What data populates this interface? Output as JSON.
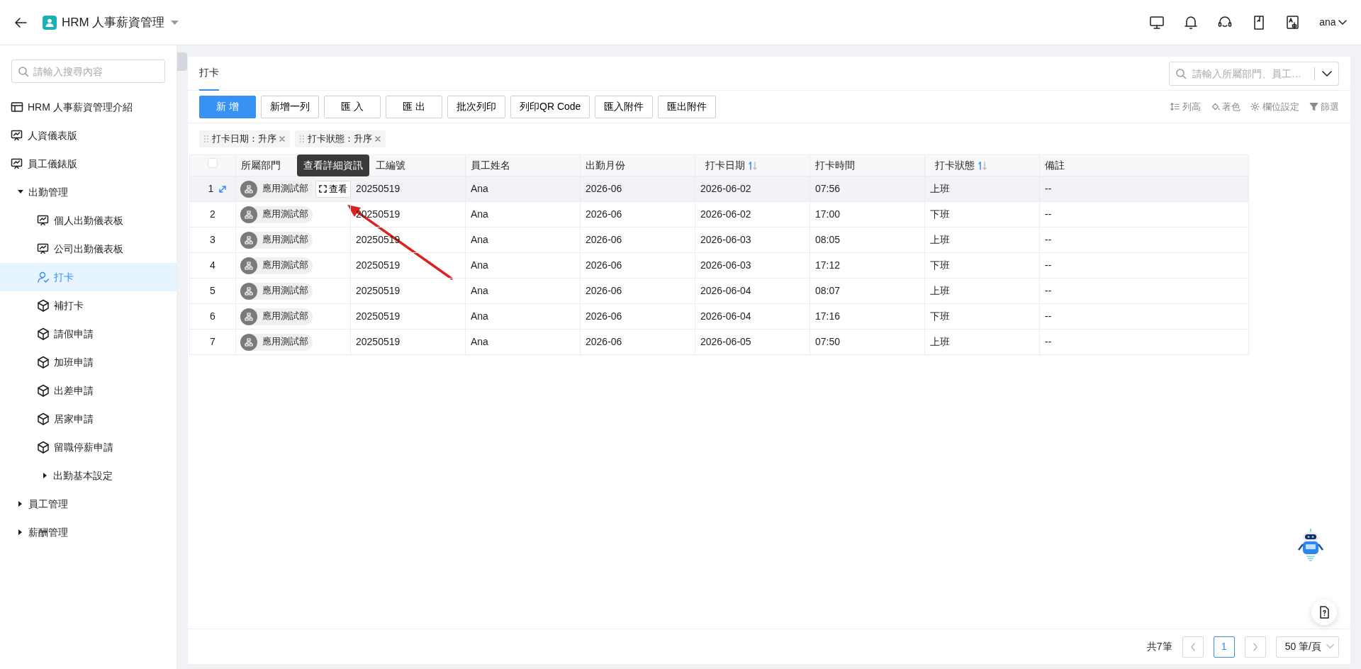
{
  "app": {
    "title": "HRM 人事薪資管理"
  },
  "user": {
    "name": "ana"
  },
  "sidebar": {
    "search": {
      "placeholder": "請輸入搜尋內容"
    },
    "items": [
      {
        "label": "HRM 人事薪資管理介紹",
        "kind": "table",
        "selected": false
      },
      {
        "label": "人資儀表版",
        "kind": "dashboard",
        "selected": false
      },
      {
        "label": "員工儀錶版",
        "kind": "dashboard",
        "selected": false
      },
      {
        "label": "出勤管理",
        "kind": "folder",
        "selected": false,
        "expanded": true,
        "children": [
          {
            "label": "個人出勤儀表板",
            "kind": "dashboard",
            "selected": false
          },
          {
            "label": "公司出勤儀表板",
            "kind": "dashboard",
            "selected": false
          },
          {
            "label": "打卡",
            "kind": "user",
            "selected": true
          },
          {
            "label": "補打卡",
            "kind": "cube",
            "selected": false
          },
          {
            "label": "請假申請",
            "kind": "cube",
            "selected": false
          },
          {
            "label": "加班申請",
            "kind": "cube",
            "selected": false
          },
          {
            "label": "出差申請",
            "kind": "cube",
            "selected": false
          },
          {
            "label": "居家申請",
            "kind": "cube",
            "selected": false
          },
          {
            "label": "留職停薪申請",
            "kind": "cube",
            "selected": false
          },
          {
            "label": "出勤基本設定",
            "kind": "folder",
            "selected": false,
            "expanded": false
          }
        ]
      },
      {
        "label": "員工管理",
        "kind": "folder",
        "selected": false,
        "expanded": false
      },
      {
        "label": "薪酬管理",
        "kind": "folder",
        "selected": false,
        "expanded": false
      }
    ]
  },
  "page": {
    "tabs": [
      {
        "label": "打卡",
        "selected": true
      }
    ],
    "search": {
      "placeholder": "請輸入所屬部門、員工…"
    },
    "buttons": [
      {
        "label": "新 增",
        "kind": "primary"
      },
      {
        "label": "新增一列",
        "kind": "default"
      },
      {
        "label": "匯 入",
        "kind": "default"
      },
      {
        "label": "匯 出",
        "kind": "default"
      },
      {
        "label": "批次列印",
        "kind": "default"
      },
      {
        "label": "列印QR Code",
        "kind": "default"
      },
      {
        "label": "匯入附件",
        "kind": "default"
      },
      {
        "label": "匯出附件",
        "kind": "default"
      }
    ],
    "tools": [
      {
        "label": "列高",
        "kind": "row-height"
      },
      {
        "label": "著色",
        "kind": "color"
      },
      {
        "label": "欄位設定",
        "kind": "settings"
      },
      {
        "label": "篩選",
        "kind": "filter"
      }
    ],
    "sort_chips": [
      {
        "label": "打卡日期：升序"
      },
      {
        "label": "打卡狀態：升序"
      }
    ]
  },
  "table": {
    "select_all_checked": false,
    "columns": [
      {
        "label": "所屬部門"
      },
      {
        "label": "工編號"
      },
      {
        "label": "員工姓名"
      },
      {
        "label": "出勤月份"
      },
      {
        "label": "打卡日期",
        "sorted_ascending": true
      },
      {
        "label": "打卡時間"
      },
      {
        "label": "打卡狀態",
        "sorted_ascending": true
      },
      {
        "label": "備註"
      }
    ],
    "rows": [
      {
        "index": "1",
        "hovered": true,
        "view_button": "查看",
        "tooltip": "查看詳細資訊",
        "cells": [
          "應用測試部",
          "20250519",
          "Ana",
          "2026-06",
          "2026-06-02",
          "07:56",
          "上班",
          "--"
        ]
      },
      {
        "index": "2",
        "hovered": false,
        "cells": [
          "應用測試部",
          "20250519",
          "Ana",
          "2026-06",
          "2026-06-02",
          "17:00",
          "下班",
          "--"
        ]
      },
      {
        "index": "3",
        "hovered": false,
        "cells": [
          "應用測試部",
          "20250519",
          "Ana",
          "2026-06",
          "2026-06-03",
          "08:05",
          "上班",
          "--"
        ]
      },
      {
        "index": "4",
        "hovered": false,
        "cells": [
          "應用測試部",
          "20250519",
          "Ana",
          "2026-06",
          "2026-06-03",
          "17:12",
          "下班",
          "--"
        ]
      },
      {
        "index": "5",
        "hovered": false,
        "cells": [
          "應用測試部",
          "20250519",
          "Ana",
          "2026-06",
          "2026-06-04",
          "08:07",
          "上班",
          "--"
        ]
      },
      {
        "index": "6",
        "hovered": false,
        "cells": [
          "應用測試部",
          "20250519",
          "Ana",
          "2026-06",
          "2026-06-04",
          "17:16",
          "下班",
          "--"
        ]
      },
      {
        "index": "7",
        "hovered": false,
        "cells": [
          "應用測試部",
          "20250519",
          "Ana",
          "2026-06",
          "2026-06-05",
          "07:50",
          "上班",
          "--"
        ]
      }
    ]
  },
  "pagination": {
    "total": "共7筆",
    "pages": [
      {
        "label": "1",
        "selected": true
      }
    ],
    "page_size": "50 筆/頁"
  }
}
